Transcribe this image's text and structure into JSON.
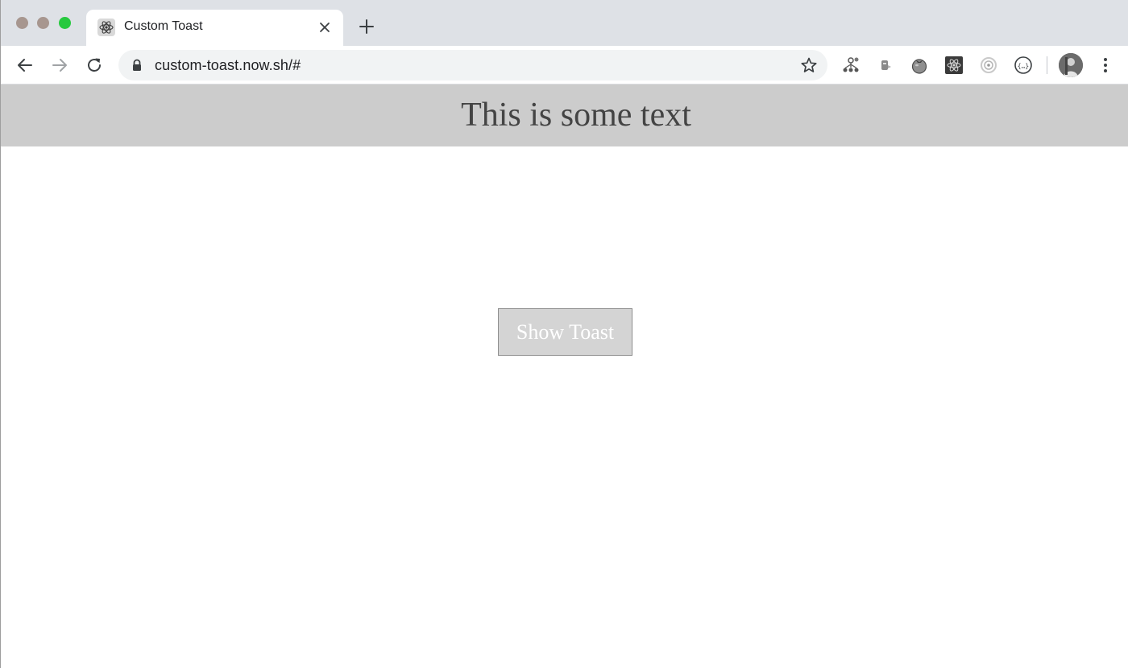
{
  "browser": {
    "tab": {
      "title": "Custom Toast",
      "favicon": "react-icon"
    },
    "address_bar": {
      "url": "custom-toast.now.sh/#"
    },
    "extensions": [
      "extension-graph-icon",
      "extension-tool-icon",
      "extension-tomato-icon",
      "extension-react-devtools-icon",
      "extension-target-icon",
      "extension-json-icon"
    ]
  },
  "page": {
    "banner_text": "This is some text",
    "show_toast_label": "Show Toast"
  },
  "colors": {
    "banner_background": "#cccccc",
    "button_background": "#d4d4d4",
    "button_text": "#ffffff",
    "traffic_close": "#a7968f",
    "traffic_minimize": "#a7968f",
    "traffic_maximize": "#27c93f"
  }
}
